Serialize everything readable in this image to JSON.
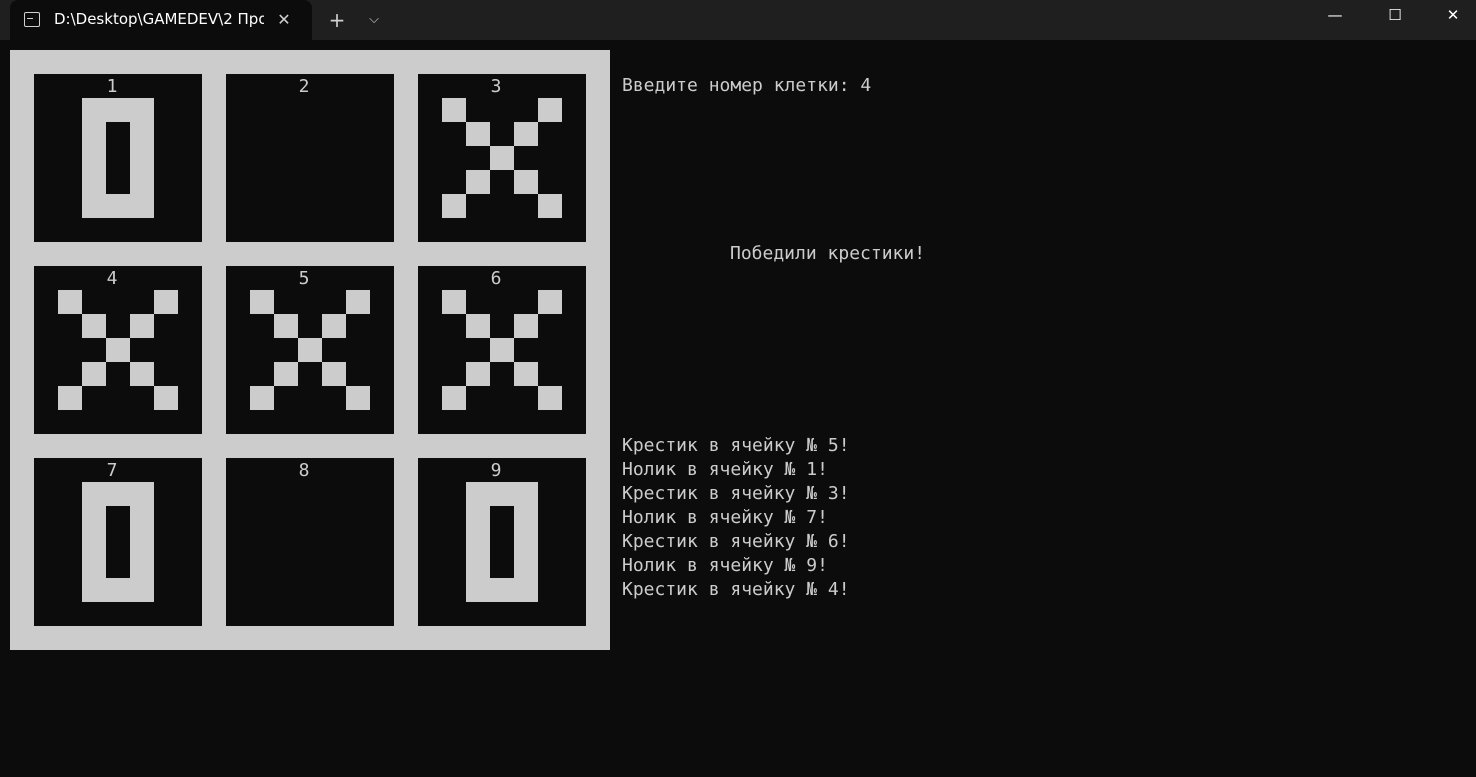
{
  "window": {
    "tab_title": "D:\\Desktop\\GAMEDEV\\2 Про",
    "tab_close_glyph": "✕",
    "new_tab_glyph": "+",
    "dropdown_glyph": "⌵",
    "minimize_glyph": "—",
    "maximize_glyph": "☐",
    "close_glyph": "✕"
  },
  "board": {
    "cells": [
      {
        "num": "1",
        "mark": "O"
      },
      {
        "num": "2",
        "mark": ""
      },
      {
        "num": "3",
        "mark": "X"
      },
      {
        "num": "4",
        "mark": "X"
      },
      {
        "num": "5",
        "mark": "X"
      },
      {
        "num": "6",
        "mark": "X"
      },
      {
        "num": "7",
        "mark": "O"
      },
      {
        "num": "8",
        "mark": ""
      },
      {
        "num": "9",
        "mark": "O"
      }
    ]
  },
  "console": {
    "prompt": "Введите номер клетки: 4",
    "result": "Победили крестики!",
    "log": [
      "Крестик в ячейку № 5!",
      "Нолик в ячейку № 1!",
      "Крестик в ячейку № 3!",
      "Нолик в ячейку № 7!",
      "Крестик в ячейку № 6!",
      "Нолик в ячейку № 9!",
      "Крестик в ячейку № 4!"
    ]
  },
  "colors": {
    "background": "#0c0c0c",
    "foreground": "#cccccc",
    "titlebar": "#1f1f1f"
  }
}
